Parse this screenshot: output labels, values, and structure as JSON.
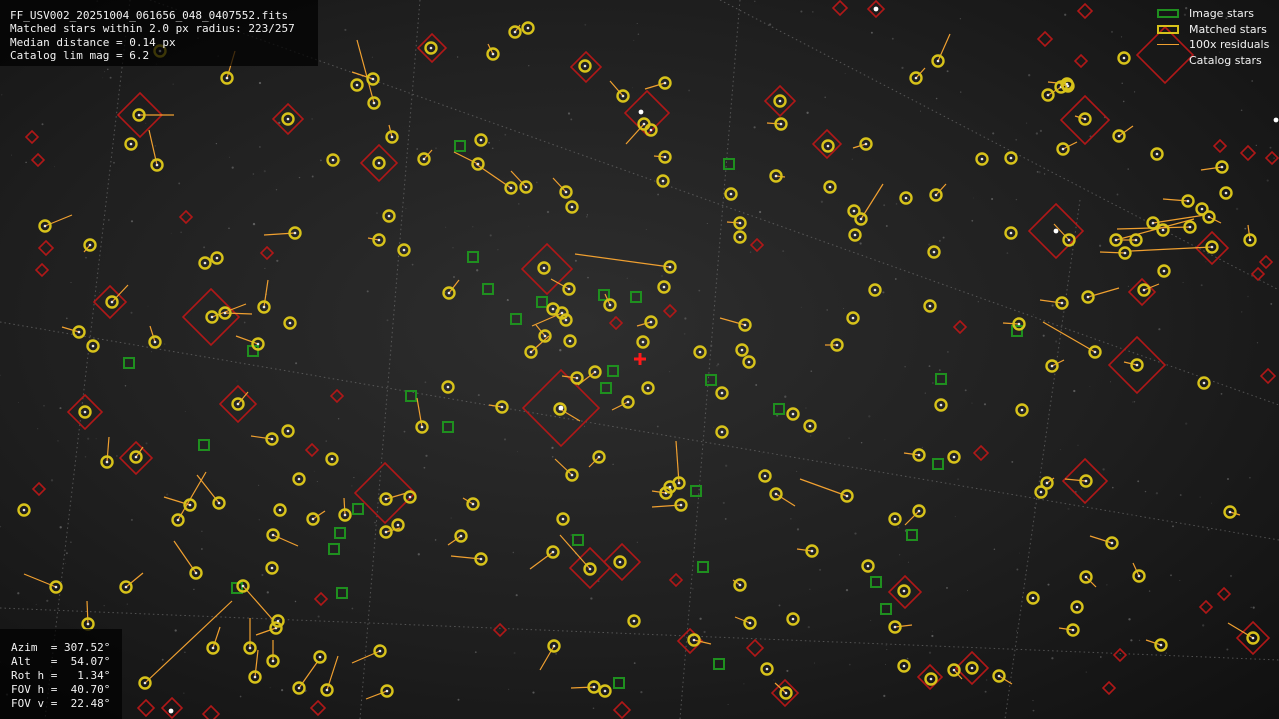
{
  "header": {
    "filename": "FF_USV002_20251004_061656_048_0407552.fits",
    "matched_line": "Matched stars within 2.0 px radius: 223/257",
    "median_line": "Median distance = 0.14 px",
    "catalog_line": "Catalog lim mag = 6.2"
  },
  "pointing": {
    "azim": "Azim  = 307.52°",
    "alt": "Alt   =  54.07°",
    "rot": "Rot h =   1.34°",
    "fov_h": "FOV h =  40.70°",
    "fov_v": "FOV v =  22.48°"
  },
  "legend": [
    {
      "label": "Image stars",
      "style": "green"
    },
    {
      "label": "Matched stars",
      "style": "yellow"
    },
    {
      "label": "100x residuals",
      "style": "line"
    },
    {
      "label": "Catalog stars",
      "style": "none"
    }
  ],
  "colors": {
    "image_star": "#1f8f1f",
    "matched_star": "#d7c21a",
    "residual": "#f0a030",
    "catalog_star": "#b01818",
    "center_marker": "#ff1a1a",
    "grid": "#7a7a7a"
  },
  "icons": {
    "center": "plus-marker"
  }
}
